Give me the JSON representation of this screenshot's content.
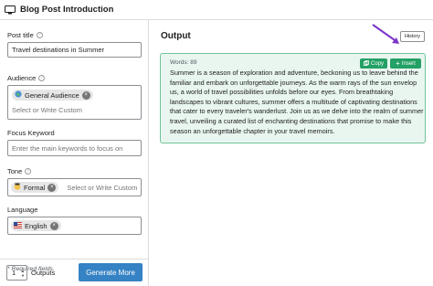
{
  "window": {
    "title": "Blog Post Introduction",
    "icon": "monitor-icon"
  },
  "form": {
    "post_title": {
      "label": "Post title",
      "value": "Travel destinations in Summer"
    },
    "audience": {
      "label": "Audience",
      "chip": "General Audience",
      "chip_icon": "globe-icon",
      "placeholder": "Select or Write Custom"
    },
    "focus_keyword": {
      "label": "Focus Keyword",
      "placeholder": "Enter the main keywords to focus on"
    },
    "tone": {
      "label": "Tone",
      "chip": "Formal",
      "chip_icon": "formal-emoji-icon",
      "placeholder": "Select or Write Custom"
    },
    "language": {
      "label": "Language",
      "chip": "English",
      "chip_icon": "us-flag-icon"
    },
    "required_note": "* Required fields."
  },
  "bottom": {
    "outputs_count": "1",
    "outputs_label": "Outputs",
    "generate_label": "Generate More"
  },
  "output": {
    "title": "Output",
    "history_label": "History",
    "words_label": "Words: 89",
    "copy_label": "Copy",
    "insert_label": "Insert",
    "text": "Summer is a season of exploration and adventure, beckoning us to leave behind the familiar and embark on unforgettable journeys. As the warm rays of the sun envelop us, a world of travel possibilities unfolds before our eyes. From breathtaking landscapes to vibrant cultures, summer offers a multitude of captivating destinations that cater to every traveler's wanderlust. Join us as we delve into the realm of summer travel, unveiling a curated list of enchanting destinations that promise to make this season an unforgettable chapter in your travel memoirs."
  },
  "colors": {
    "accent_blue": "#3582c4",
    "accent_green": "#23a065",
    "card_bg": "#e9f6f0",
    "annotation_arrow": "#7b35c9"
  }
}
